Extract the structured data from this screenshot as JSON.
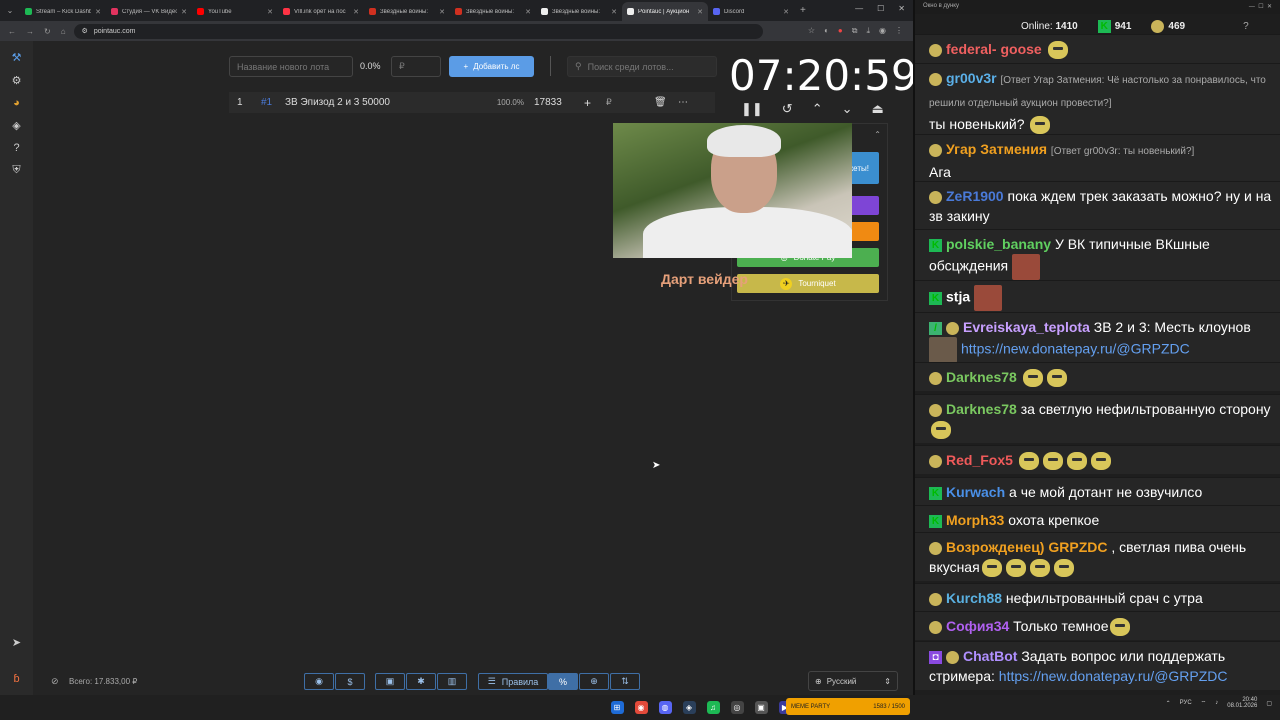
{
  "tabs": [
    {
      "label": "Stream – Kick Dashb",
      "color": "#1db954"
    },
    {
      "label": "Студия — VK Видео",
      "color": "#e2335f"
    },
    {
      "label": "YouTube",
      "color": "#ff0000"
    },
    {
      "label": "VIll.ink орёт на пос",
      "color": "#ff3344"
    },
    {
      "label": "Звёздные войны: ",
      "color": "#d03020"
    },
    {
      "label": "Звёздные войны: ",
      "color": "#d03020"
    },
    {
      "label": "Звёздные войны: ",
      "color": "#eeeeee"
    },
    {
      "label": "Pointauc | Аукцион",
      "color": "#eeeeee"
    },
    {
      "label": "Discord",
      "color": "#5865f2"
    }
  ],
  "address": {
    "url": "pointauc.com"
  },
  "lot_form": {
    "name_placeholder": "Название нового лота",
    "percent": "0.0%",
    "amount_placeholder": "₽",
    "add_label": "Добавить лс",
    "search_placeholder": "Поиск среди лотов..."
  },
  "timer": "07:20:59",
  "lots": [
    {
      "num": "1",
      "id": "#1",
      "name": "ЗВ Эпизод 2 и 3 50000",
      "percent": "100.0%",
      "amount": "17833",
      "currency": "₽"
    }
  ],
  "donation_panel": {
    "visible_fragment": "жеты!",
    "buttons": [
      {
        "label": "",
        "color": "#3b8fd0"
      },
      {
        "label": "",
        "color": "#7e45d6"
      },
      {
        "label": "",
        "color": "#f08a12"
      },
      {
        "label": "Donate Pay",
        "color": "#4caf50"
      },
      {
        "label": "Tourniquet",
        "color": "#c7b84a"
      }
    ]
  },
  "overlay_text": "Дарт вейдер",
  "footer": {
    "total": "Всего: 17.833,00 ₽",
    "rules_label": "Правила",
    "language": "Русский"
  },
  "chat": {
    "window_title": "Окно в дунку",
    "online_label": "Online:",
    "online": "1410",
    "kick_count": "941",
    "vk_count": "469",
    "messages": [
      {
        "nick": "federal- goose",
        "color": "#f06060",
        "badge": "emote",
        "reply": "",
        "text": ""
      },
      {
        "nick": "gr00v3r",
        "color": "#5bb0e8",
        "badge": "emote",
        "reply": "[Ответ Угар Затмения: Чё настолько за понравилось, что решили отдельный аукцион провести?]",
        "text": "ты новенький?"
      },
      {
        "nick": "Угар Затмения",
        "color": "#f0a020",
        "badge": "emote",
        "reply": "[Ответ gr00v3r: ты новенький?]",
        "text": "Ага"
      },
      {
        "nick": "ZeR1900",
        "color": "#4a7ad8",
        "badge": "emote",
        "reply": "",
        "text": "пока ждем трек заказать можно? ну и на зв закину"
      },
      {
        "nick": "polskie_banany",
        "color": "#60d060",
        "badge": "kick",
        "reply": "",
        "text": "У ВК типичные ВКшные обсцждения"
      },
      {
        "nick": "stja",
        "color": "#fff",
        "badge": "kick",
        "reply": "",
        "text": ""
      },
      {
        "nick": "Evreiskaya_teplota",
        "color": "#c8a0ff",
        "badge": "emote",
        "reply": "",
        "text": "ЗВ 2 и 3: Месть клоунов",
        "link": "https://new.donatepay.ru/@GRPZDC"
      },
      {
        "nick": "Darknes78",
        "color": "#7ac860",
        "badge": "emote",
        "reply": "",
        "text": ""
      },
      {
        "nick": "Darknes78",
        "color": "#7ac860",
        "badge": "emote",
        "reply": "",
        "text": "за светлую нефильтрованную сторону"
      },
      {
        "nick": "Red_Fox5",
        "color": "#f05a5a",
        "badge": "emote",
        "reply": "",
        "text": ""
      },
      {
        "nick": "Kurwach",
        "color": "#4a90e8",
        "badge": "kick",
        "reply": "",
        "text": "а че мой дотант не озвучилсо"
      },
      {
        "nick": "Morph33",
        "color": "#f0a020",
        "badge": "kick",
        "reply": "",
        "text": "охота крепкое"
      },
      {
        "nick": "Возрожденец) GRPZDC",
        "color": "#f0a020",
        "badge": "emote",
        "reply": "",
        "text": ", светлая пива очень вкусная"
      },
      {
        "nick": "Kurch88",
        "color": "#5ab0e0",
        "badge": "emote",
        "reply": "",
        "text": "нефильтрованный срач с утра"
      },
      {
        "nick": "София34",
        "color": "#b060f0",
        "badge": "emote",
        "reply": "",
        "text": "Только темное"
      },
      {
        "nick": "ChatBot",
        "color": "#b090ff",
        "badge": "bot",
        "reply": "",
        "text": "Задать вопрос или поддержать стримера:",
        "link": "https://new.donatepay.ru/@GRPZDC"
      }
    ]
  },
  "taskbar": {
    "media_label": "MEME PARTY",
    "media_count": "1583 / 1500",
    "lang": "РУС",
    "time": "20:40",
    "date": "08.01.2026"
  }
}
